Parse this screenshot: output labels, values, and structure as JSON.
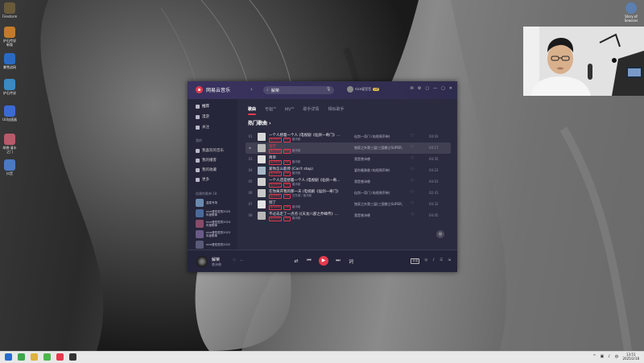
{
  "desktop": {
    "icons_left": [
      {
        "label": "Firestorm",
        "color": "#6a5a3a"
      },
      {
        "label": "炉石传说\n新版",
        "color": "#c47a2a"
      },
      {
        "label": "暴雪战网",
        "color": "#2a6ac4"
      },
      {
        "label": "炉石传说",
        "color": "#3a8ac4"
      },
      {
        "label": "UU加速器",
        "color": "#3a6ad4"
      },
      {
        "label": "胡桃·清水\n之门",
        "color": "#b85a6a"
      },
      {
        "label": "抖音",
        "color": "#4a7ac4"
      }
    ],
    "icon_right": {
      "label": "Story of\nSeasons",
      "color": "#5a7fb0"
    }
  },
  "app": {
    "name": "网易云音乐",
    "back": "‹",
    "search": {
      "value": "解荣",
      "placeholder": ""
    },
    "user": {
      "name": "nice爱哲哲",
      "vip": "VIP"
    },
    "window_controls": [
      "✉",
      "⚙",
      "▢",
      "—",
      "▢",
      "✕"
    ],
    "sidebar": {
      "top_items": [
        {
          "label": "推荐",
          "icon": "home-icon"
        },
        {
          "label": "漫游",
          "icon": "radio-icon"
        },
        {
          "label": "关注",
          "icon": "follow-icon"
        }
      ],
      "section_mine": "我的",
      "mine_items": [
        {
          "label": "我喜欢的音乐",
          "icon": "heart-icon"
        },
        {
          "label": "我的播客",
          "icon": "podcast-icon"
        },
        {
          "label": "我的收藏",
          "icon": "star-icon"
        },
        {
          "label": "更多",
          "icon": "more-icon"
        }
      ],
      "section_created": "创建的歌单 18",
      "playlists": [
        {
          "title": "温柔专场",
          "color": "#6a8ab0"
        },
        {
          "title": "nice爱哲哲的2025\n年度歌单",
          "color": "#4a6a9a"
        },
        {
          "title": "nice爱哲哲的2024\n年度歌单",
          "color": "#8a4a6a"
        },
        {
          "title": "nice爱哲哲的2023\n年度歌单",
          "color": "#6a5a8a"
        },
        {
          "title": "nice爱哲哲的2022\n",
          "color": "#5a5a7a"
        }
      ]
    },
    "tabs": [
      {
        "label": "歌曲",
        "count": "",
        "active": true
      },
      {
        "label": "专辑",
        "count": "36",
        "active": false
      },
      {
        "label": "MV",
        "count": "26",
        "active": false
      },
      {
        "label": "歌手详情",
        "count": "",
        "active": false
      },
      {
        "label": "相似歌手",
        "count": "",
        "active": false
      }
    ],
    "section_title": "热门歌曲 ›",
    "songs": [
      {
        "num": "01",
        "title": "一个人想着一个人 (电视剧《仙剑一奇门》...",
        "tags": [
          "超清母带",
          "VIP"
        ],
        "artist": "曾沛慈",
        "album": "仙剑一奇门 (电视原声带)",
        "duration": "04:03",
        "current": false,
        "cover": "#d8d8d8"
      },
      {
        "num": "▶",
        "title": "烟芳",
        "tags": [
          "超清母带",
          "VIP"
        ],
        "artist": "曾沛慈",
        "album": "独家之外第三届(三国鼎立SUPER大...",
        "duration": "04:17",
        "current": true,
        "cover": "#bcbcbc"
      },
      {
        "num": "03",
        "title": "简单",
        "tags": [
          "超清母带",
          "VIP"
        ],
        "artist": "曾沛慈",
        "album": "我是曾沛慈",
        "duration": "04:35",
        "current": false,
        "cover": "#e0e0e0"
      },
      {
        "num": "04",
        "title": "爱你怎么能停 (Can't stop)",
        "tags": [
          "超清母带",
          "VIP"
        ],
        "artist": "曾沛慈",
        "album": "爱你最勇敢 (电视原声带)",
        "duration": "04:22",
        "current": false,
        "cover": "#a8b8c8"
      },
      {
        "num": "05",
        "title": "一个人还是想着一个人 (电视剧《仙剑一奇...",
        "tags": [
          "超清母带",
          "VIP"
        ],
        "artist": "曾沛慈",
        "album": "我是曾沛慈",
        "duration": "04:03",
        "current": false,
        "cover": "#d0d0d0"
      },
      {
        "num": "06",
        "title": "在你离开我的那一天 (电视剧《仙剑一奇门》插...",
        "tags": [
          "超清母带",
          "VIP"
        ],
        "artist": "汪东城 / 曾沛慈",
        "album": "仙剑一奇门 (电视原声带)",
        "duration": "02:41",
        "current": false,
        "cover": "#c8c8c8"
      },
      {
        "num": "07",
        "title": "到了",
        "tags": [
          "超清母带",
          "VIP"
        ],
        "artist": "曾沛慈",
        "album": "独家之外第三届(三国鼎立SUPER大...",
        "duration": "04:32",
        "current": false,
        "cover": "#e4e4e4"
      },
      {
        "num": "08",
        "title": "不过去走了一点点 (《天龙八部之乔峰传》...",
        "tags": [
          "超清母带",
          "VIP"
        ],
        "artist": "曾沛慈",
        "album": "我是曾沛慈",
        "duration": "04:05",
        "current": false,
        "cover": "#b8b8b8"
      }
    ],
    "player": {
      "title": "解荣",
      "artist": "曾沛慈",
      "extra": "♡ ··· ",
      "controls": {
        "shuffle": "⇄",
        "prev": "⏮",
        "play": "▶",
        "next": "⏭",
        "lyric": "词"
      },
      "right": {
        "quality": "标准",
        "items": [
          "◎",
          "♪",
          "☰",
          "⇲"
        ]
      }
    }
  },
  "taskbar": {
    "apps": [
      {
        "name": "windows-icon",
        "color": "#2a6ad4"
      },
      {
        "name": "chrome-icon",
        "color": "#3aa84a"
      },
      {
        "name": "folder-icon",
        "color": "#e0b040"
      },
      {
        "name": "wechat-icon",
        "color": "#4ab84a"
      },
      {
        "name": "netease-icon",
        "color": "#e5394d"
      },
      {
        "name": "obs-icon",
        "color": "#333333"
      }
    ],
    "tray": [
      "^",
      "▣",
      "♪",
      "中"
    ],
    "time": "13:51",
    "date": "2025/2/18"
  }
}
